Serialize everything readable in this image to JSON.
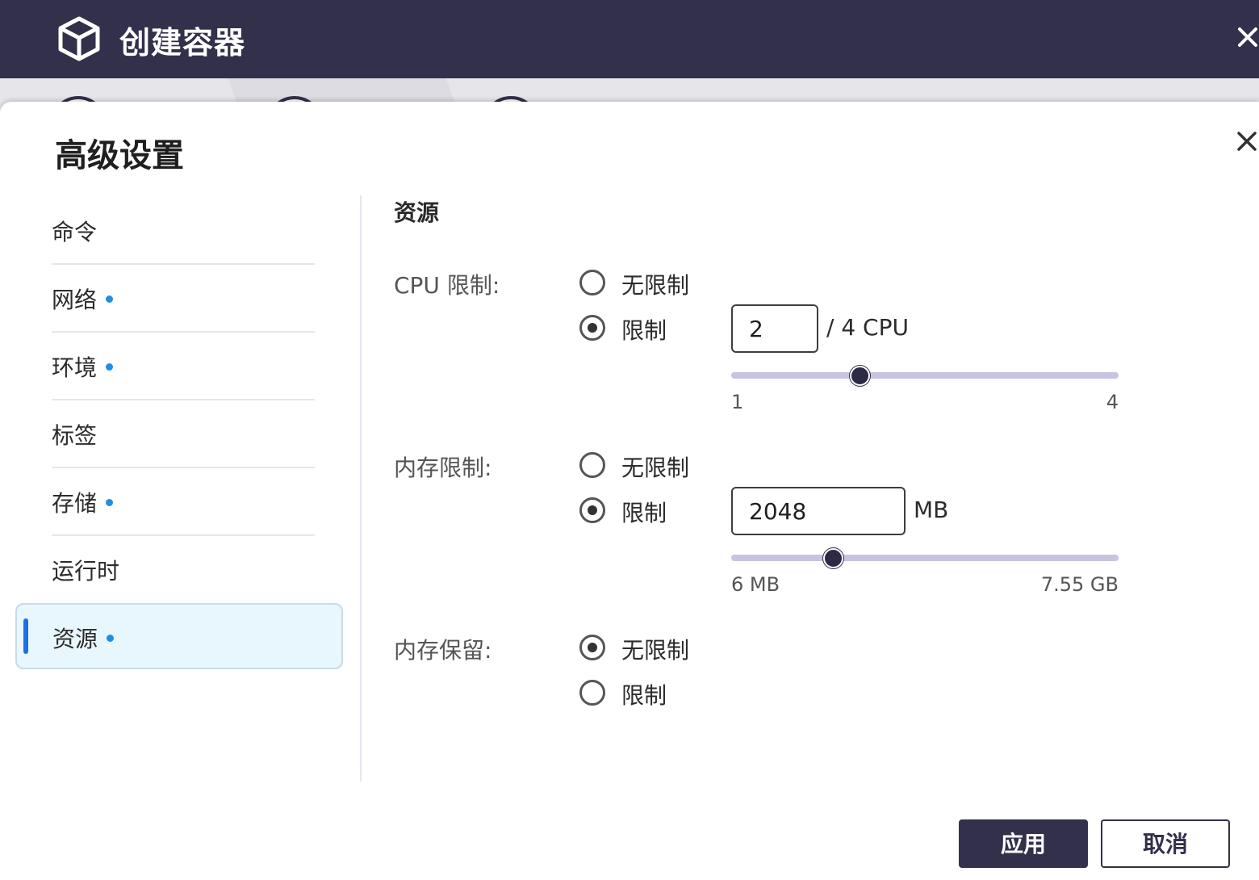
{
  "window": {
    "title": "创建容器",
    "icon": "cube-icon",
    "close_icon": "close-icon"
  },
  "dialog": {
    "title": "高级设置",
    "close_icon": "close-icon"
  },
  "sidebar": {
    "items": [
      {
        "label": "命令",
        "has_dot": false,
        "active": false
      },
      {
        "label": "网络",
        "has_dot": true,
        "active": false
      },
      {
        "label": "环境",
        "has_dot": true,
        "active": false
      },
      {
        "label": "标签",
        "has_dot": false,
        "active": false
      },
      {
        "label": "存储",
        "has_dot": true,
        "active": false
      },
      {
        "label": "运行时",
        "has_dot": false,
        "active": false
      },
      {
        "label": "资源",
        "has_dot": true,
        "active": true
      }
    ]
  },
  "content": {
    "section_title": "资源",
    "cpu": {
      "label": "CPU 限制:",
      "options": [
        "无限制",
        "限制"
      ],
      "selected": "限制",
      "value": "2",
      "unit": "/ 4 CPU",
      "slider_min": "1",
      "slider_max": "4",
      "slider_fraction": 0.333
    },
    "memory": {
      "label": "内存限制:",
      "options": [
        "无限制",
        "限制"
      ],
      "selected": "限制",
      "value": "2048",
      "unit": "MB",
      "slider_min": "6 MB",
      "slider_max": "7.55 GB",
      "slider_fraction": 0.264
    },
    "reservation": {
      "label": "内存保留:",
      "options": [
        "无限制",
        "限制"
      ],
      "selected": "无限制"
    }
  },
  "buttons": {
    "apply": "应用",
    "cancel": "取消"
  },
  "colors": {
    "titlebar": "#32304a",
    "accent_dot": "#1e8fe3",
    "active_bg": "#e8f7fd",
    "slider_track": "#c9c2e3"
  }
}
